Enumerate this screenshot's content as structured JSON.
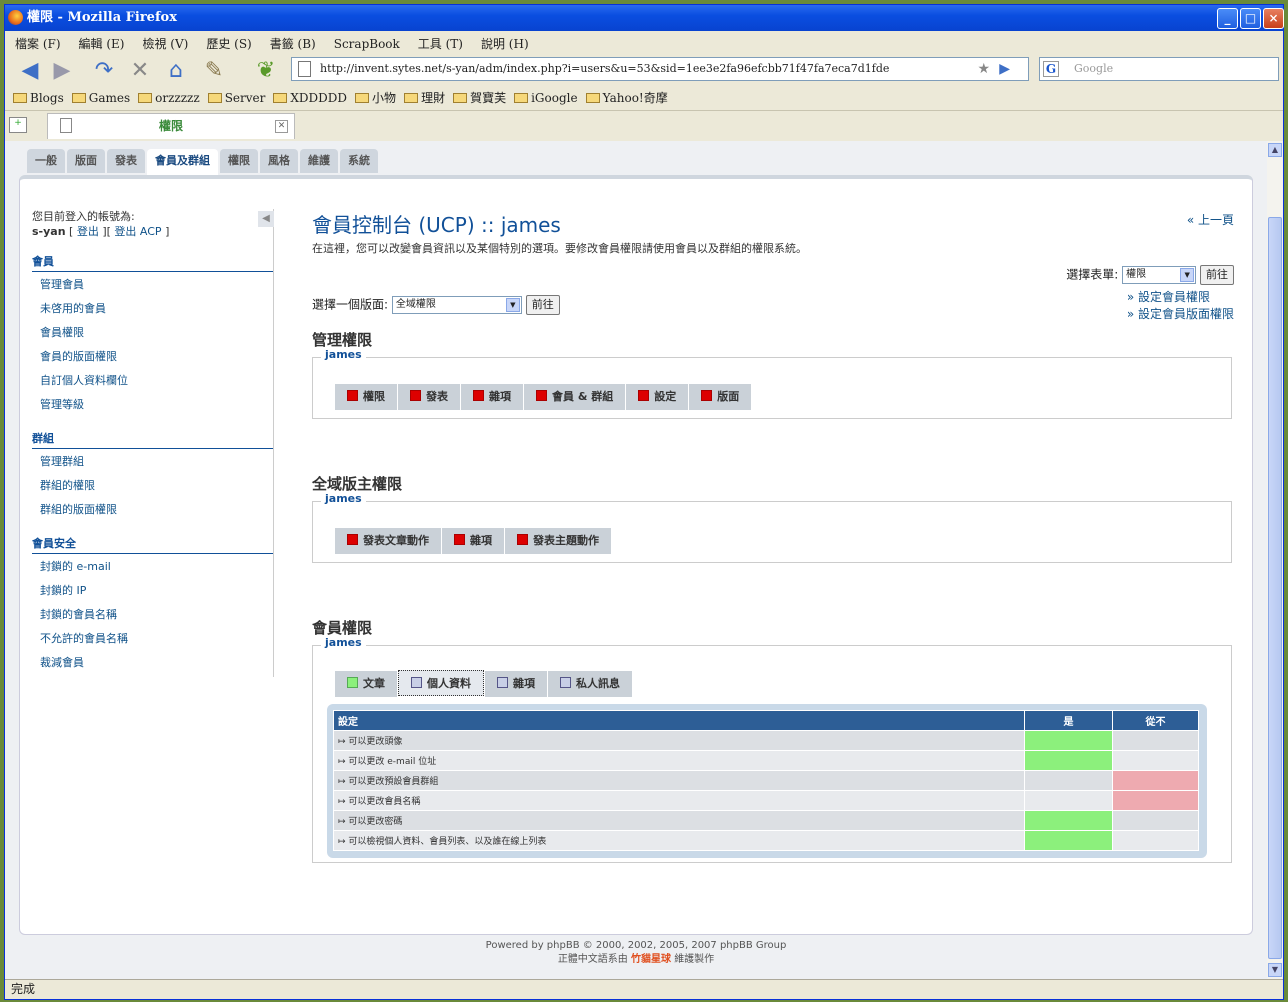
{
  "window": {
    "title": "權限 - Mozilla Firefox"
  },
  "menu": [
    "檔案 (F)",
    "編輯 (E)",
    "檢視 (V)",
    "歷史 (S)",
    "書籤 (B)",
    "ScrapBook",
    "工具 (T)",
    "說明 (H)"
  ],
  "url": "http://invent.sytes.net/s-yan/adm/index.php?i=users&u=53&sid=1ee3e2fa96efcbb71f47fa7eca7d1fde",
  "search_placeholder": "Google",
  "bookmarks": [
    "Blogs",
    "Games",
    "orzzzzz",
    "Server",
    "XDDDDD",
    "小物",
    "理財",
    "賀寶芙",
    "iGoogle",
    "Yahoo!奇摩"
  ],
  "browser_tab": "權限",
  "status": "完成",
  "acp_tabs": [
    "一般",
    "版面",
    "發表",
    "會員及群組",
    "權限",
    "風格",
    "維護",
    "系統"
  ],
  "acp_active_tab": "會員及群組",
  "sidebar": {
    "login_prefix": "您目前登入的帳號為:",
    "user": "s-yan",
    "logout": "登出",
    "logout_acp": "登出 ACP",
    "groups": [
      {
        "title": "會員",
        "items": [
          "管理會員",
          "未啓用的會員",
          "會員權限",
          "會員的版面權限",
          "自訂個人資料欄位",
          "管理等級"
        ]
      },
      {
        "title": "群組",
        "items": [
          "管理群組",
          "群組的權限",
          "群組的版面權限"
        ]
      },
      {
        "title": "會員安全",
        "items": [
          "封鎖的 e-mail",
          "封鎖的 IP",
          "封鎖的會員名稱",
          "不允許的會員名稱",
          "裁減會員"
        ]
      }
    ]
  },
  "main": {
    "title": "會員控制台 (UCP) :: james",
    "description": "在這裡，您可以改變會員資訊以及某個特別的選項。要修改會員權限請使用會員以及群組的權限系統。",
    "back": "上一頁",
    "select_form_label": "選擇表單:",
    "select_form_value": "權限",
    "go": "前往",
    "select_forum_label": "選擇一個版面:",
    "select_forum_value": "全域權限",
    "link_set_user_perm": "設定會員權限",
    "link_set_user_forum_perm": "設定會員版面權限",
    "sections": [
      {
        "title": "管理權限",
        "user": "james",
        "tabs": [
          "權限",
          "發表",
          "雜項",
          "會員 & 群組",
          "設定",
          "版面"
        ],
        "colors": [
          "r",
          "r",
          "r",
          "r",
          "r",
          "r"
        ]
      },
      {
        "title": "全域版主權限",
        "user": "james",
        "tabs": [
          "發表文章動作",
          "雜項",
          "發表主題動作"
        ],
        "colors": [
          "r",
          "r",
          "r"
        ]
      },
      {
        "title": "會員權限",
        "user": "james",
        "tabs": [
          "文章",
          "個人資料",
          "雜項",
          "私人訊息"
        ],
        "colors": [
          "g",
          "b",
          "b",
          "b"
        ],
        "active": 1
      }
    ],
    "grid": {
      "headers": [
        "設定",
        "是",
        "從不"
      ],
      "rows": [
        {
          "label": "可以更改頭像",
          "value": "yes"
        },
        {
          "label": "可以更改 e-mail 位址",
          "value": "yes"
        },
        {
          "label": "可以更改預設會員群組",
          "value": "no"
        },
        {
          "label": "可以更改會員名稱",
          "value": "no"
        },
        {
          "label": "可以更改密碼",
          "value": "yes"
        },
        {
          "label": "可以檢視個人資料、會員列表、以及誰在線上列表",
          "value": "yes"
        }
      ]
    }
  },
  "footer": {
    "line1": "Powered by phpBB © 2000, 2002, 2005, 2007 phpBB Group",
    "tw_prefix": "正體中文語系由",
    "tw_name": "竹貓星球",
    "tw_suffix": "維護製作"
  },
  "colors": {
    "header_blue": "#2d5e96",
    "yes": "#8cf07c",
    "no": "#eeaab0",
    "never_red": "#dd0000"
  }
}
